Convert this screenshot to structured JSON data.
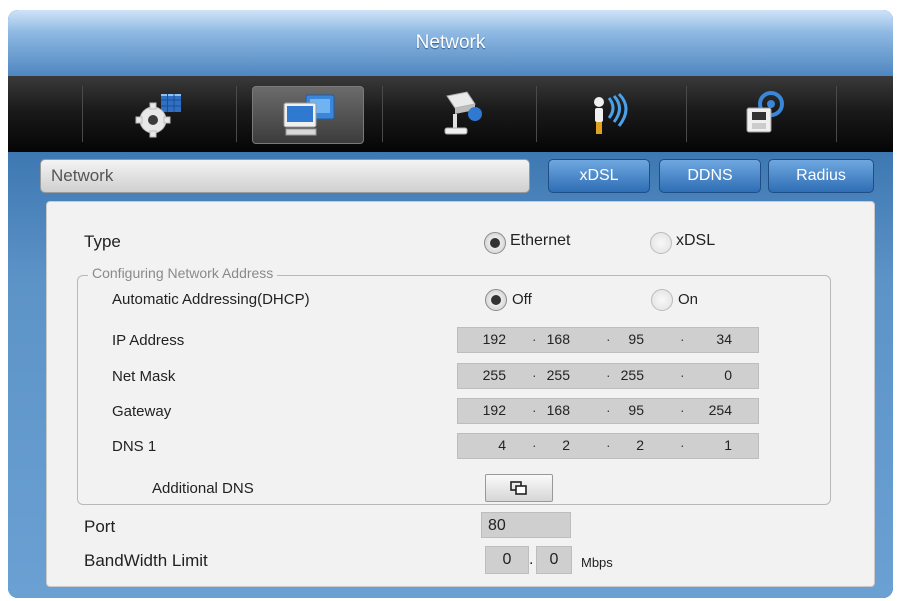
{
  "window": {
    "title": "Network"
  },
  "toolbar": {
    "icons": [
      "system-settings-icon",
      "network-icon",
      "device-icon",
      "wireless-icon",
      "storage-icon"
    ]
  },
  "section": {
    "title": "Network",
    "tabs": [
      "xDSL",
      "DDNS",
      "Radius"
    ]
  },
  "type": {
    "label": "Type",
    "options": [
      "Ethernet",
      "xDSL"
    ],
    "selected": "Ethernet"
  },
  "address": {
    "legend": "Configuring Network Address",
    "dhcp_label": "Automatic Addressing(DHCP)",
    "dhcp_options": [
      "Off",
      "On"
    ],
    "dhcp_selected": "Off",
    "fields": [
      {
        "label": "IP Address",
        "octets": [
          "192",
          "168",
          "95",
          "34"
        ]
      },
      {
        "label": "Net Mask",
        "octets": [
          "255",
          "255",
          "255",
          "0"
        ]
      },
      {
        "label": "Gateway",
        "octets": [
          "192",
          "168",
          "95",
          "254"
        ]
      },
      {
        "label": "DNS 1",
        "octets": [
          "4",
          "2",
          "2",
          "1"
        ]
      }
    ],
    "additional_dns_label": "Additional DNS"
  },
  "port": {
    "label": "Port",
    "value": "80"
  },
  "bandwidth": {
    "label": "BandWidth Limit",
    "int_value": "0",
    "dec_value": "0",
    "unit": "Mbps"
  }
}
